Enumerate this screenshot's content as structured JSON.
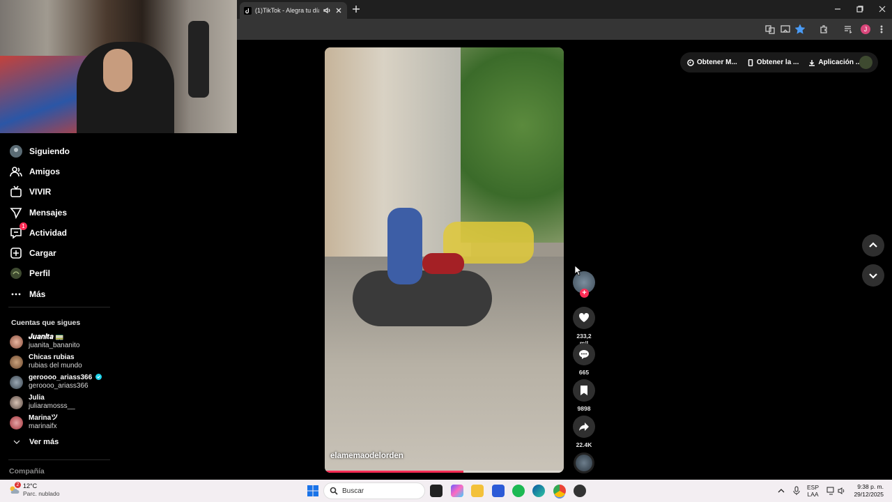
{
  "browser": {
    "tab_title": "(1)TikTok - Alegra tu día"
  },
  "top_pills": {
    "item1": "Obtener M...",
    "item2": "Obtener la ...",
    "item3": "Aplicación ..."
  },
  "sidebar": {
    "items": [
      {
        "label": "Siguiendo",
        "icon": "following-icon"
      },
      {
        "label": "Amigos",
        "icon": "friends-icon"
      },
      {
        "label": "VIVIR",
        "icon": "live-icon"
      },
      {
        "label": "Mensajes",
        "icon": "messages-icon"
      },
      {
        "label": "Actividad",
        "icon": "activity-icon",
        "badge": "1"
      },
      {
        "label": "Cargar",
        "icon": "upload-icon"
      },
      {
        "label": "Perfil",
        "icon": "profile-icon"
      },
      {
        "label": "Más",
        "icon": "more-icon"
      }
    ],
    "following_title": "Cuentas que sigues",
    "accounts": [
      {
        "name": "𝑱𝒖𝒂𝒏𝒊𝒕𝒂 🚃",
        "username": "juanita_bananito"
      },
      {
        "name": "Chicas rubias",
        "username": "rubias del mundo"
      },
      {
        "name": "geroooo_ariass366",
        "username": "geroooo_ariass366",
        "verified": true
      },
      {
        "name": "Julia",
        "username": "juliaramosss__"
      },
      {
        "name": "Marinaツ",
        "username": "marinaifx"
      }
    ],
    "see_more": "Ver más",
    "company": "Compañía"
  },
  "video": {
    "handle": "elamemaodelorden",
    "progress_fraction": 0.58
  },
  "actions": {
    "likes": "233,2 mil",
    "comments": "665",
    "saves": "9898",
    "shares": "22.4K"
  },
  "taskbar": {
    "weather_temp": "12°C",
    "weather_desc": "Parc. nublado",
    "weather_badge": "2",
    "search_placeholder": "Buscar",
    "lang_top": "ESP",
    "lang_bottom": "LAA",
    "time": "9:38 p. m.",
    "date": "29/12/2025"
  },
  "colors": {
    "accent": "#fe2c55",
    "background": "#000000"
  }
}
